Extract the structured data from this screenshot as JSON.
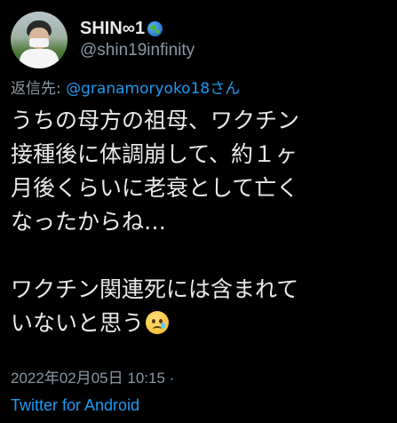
{
  "user": {
    "display_name": "SHIN∞1",
    "display_name_emoji": "globe-emoji",
    "handle": "@shin19infinity"
  },
  "reply": {
    "prefix": "返信先: ",
    "mention": "@granamoryoko18さん"
  },
  "tweet": {
    "lines": [
      "うちの母方の祖母、ワクチン",
      "接種後に体調崩して、約１ヶ",
      "月後くらいに老衰として亡く",
      "なったからね…",
      "",
      "ワクチン関連死には含まれて",
      "いないと思う"
    ],
    "trailing_emoji": "sad-but-relieved-face-emoji"
  },
  "meta": {
    "timestamp": "2022年02月05日 10:15 ·",
    "source": "Twitter for Android"
  },
  "colors": {
    "background": "#000000",
    "text": "#e7e9ea",
    "secondary": "#8b98a5",
    "link": "#1d9bf0"
  }
}
